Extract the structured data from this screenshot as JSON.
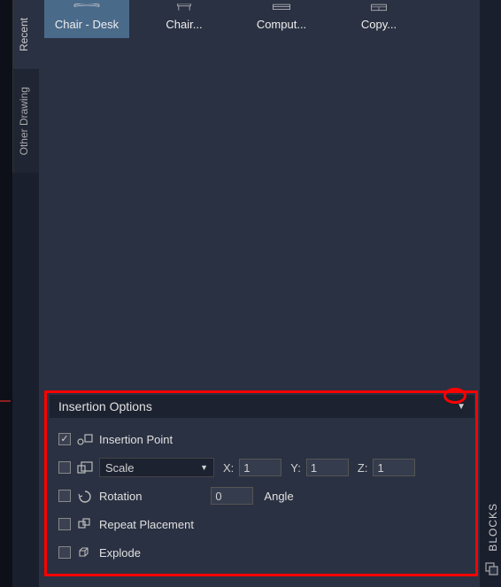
{
  "tabs": {
    "recent": "Recent",
    "other_drawing": "Other Drawing"
  },
  "right_panel_label": "BLOCKS",
  "blocks": [
    {
      "label": "Chair - Desk"
    },
    {
      "label": "Chair..."
    },
    {
      "label": "Comput..."
    },
    {
      "label": "Copy..."
    }
  ],
  "insertion": {
    "header": "Insertion Options",
    "point_label": "Insertion Point",
    "scale_label": "Scale",
    "x_label": "X:",
    "y_label": "Y:",
    "z_label": "Z:",
    "x_val": "1",
    "y_val": "1",
    "z_val": "1",
    "rotation_label": "Rotation",
    "rotation_val": "0",
    "angle_label": "Angle",
    "repeat_label": "Repeat Placement",
    "explode_label": "Explode"
  }
}
